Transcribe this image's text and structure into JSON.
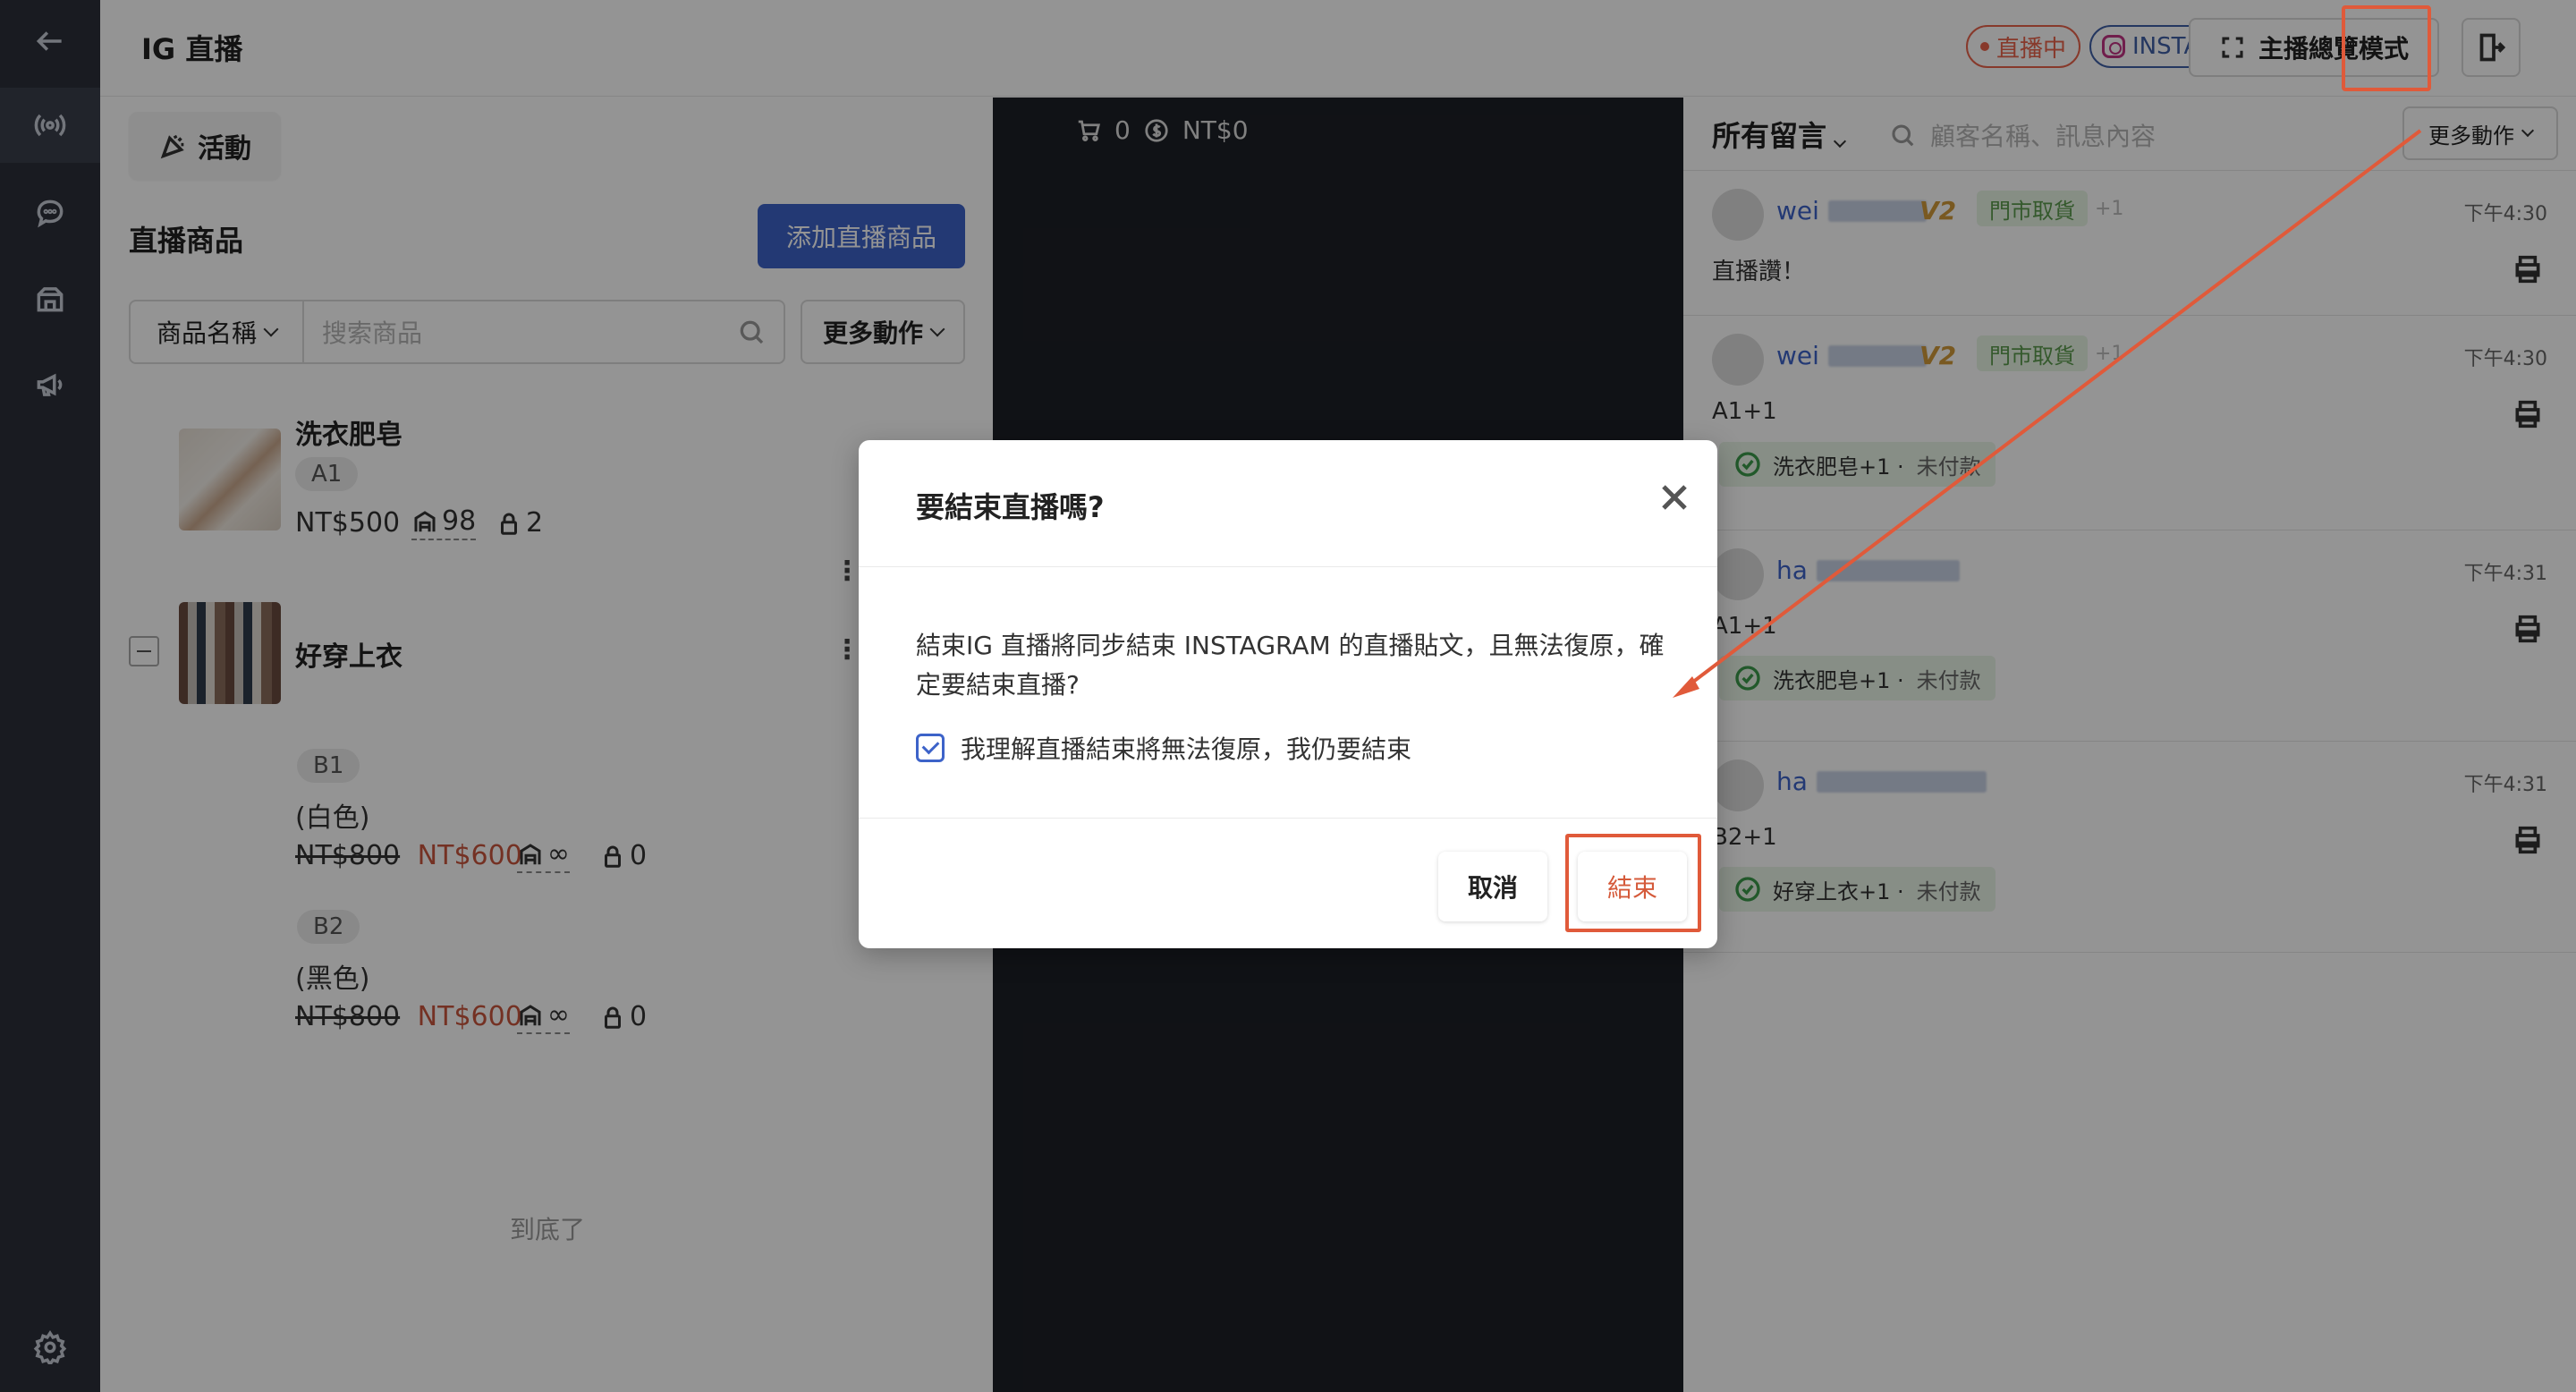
{
  "topbar": {
    "title": "IG 直播",
    "live_badge": "直播中",
    "platform_badge": "INSTAGRAM",
    "overview_button": "主播總覽模式"
  },
  "sidebar": {
    "items": [
      {
        "icon": "back-arrow-icon"
      },
      {
        "icon": "live-broadcast-icon"
      },
      {
        "icon": "chat-icon"
      },
      {
        "icon": "store-icon"
      },
      {
        "icon": "megaphone-icon"
      },
      {
        "icon": "gear-icon"
      }
    ]
  },
  "left": {
    "activity_tab": "活動",
    "section_title": "直播商品",
    "add_button": "添加直播商品",
    "filter_select": "商品名稱",
    "search_placeholder": "搜索商品",
    "more_actions": "更多動作",
    "end_note": "到底了",
    "products": [
      {
        "name": "洗衣肥皂",
        "sku": "A1",
        "price": "NT$500",
        "stock": "98",
        "locked": "2"
      },
      {
        "name": "好穿上衣",
        "variants": [
          {
            "sku": "B1",
            "label": "(白色)",
            "old_price": "NT$800",
            "price": "NT$600",
            "stock": "∞",
            "locked": "0"
          },
          {
            "sku": "B2",
            "label": "(黑色)",
            "old_price": "NT$800",
            "price": "NT$600",
            "stock": "∞",
            "locked": "0"
          }
        ]
      }
    ]
  },
  "video": {
    "cart_count": "0",
    "amount": "NT$0"
  },
  "comments": {
    "header": "所有留言",
    "search_placeholder": "顧客名稱、訊息內容",
    "more_actions": "更多動作",
    "items": [
      {
        "name": "wei",
        "level": "V2",
        "tag": "門市取貨",
        "extra": "+1",
        "time": "下午4:30",
        "text": "直播讚！"
      },
      {
        "name": "wei",
        "level": "V2",
        "tag": "門市取貨",
        "extra": "+1",
        "time": "下午4:30",
        "text": "A1+1",
        "order": "洗衣肥皂+1 ·",
        "order_status": "未付款"
      },
      {
        "name": "ha",
        "time": "下午4:31",
        "text": "A1+1",
        "order": "洗衣肥皂+1 ·",
        "order_status": "未付款"
      },
      {
        "name": "ha",
        "time": "下午4:31",
        "text": "B2+1",
        "order": "好穿上衣+1 ·",
        "order_status": "未付款"
      }
    ]
  },
  "modal": {
    "title": "要結束直播嗎?",
    "body": "結束IG 直播將同步結束 INSTAGRAM 的直播貼文，且無法復原，確定要結束直播?",
    "checkbox_label": "我理解直播結束將無法復原，我仍要結束",
    "checkbox_checked": true,
    "cancel": "取消",
    "confirm": "結束"
  },
  "colors": {
    "accent": "#3d63c9",
    "danger": "#d55a3a",
    "annotation": "#e05a3a",
    "sidebar": "#2b2f3a"
  }
}
